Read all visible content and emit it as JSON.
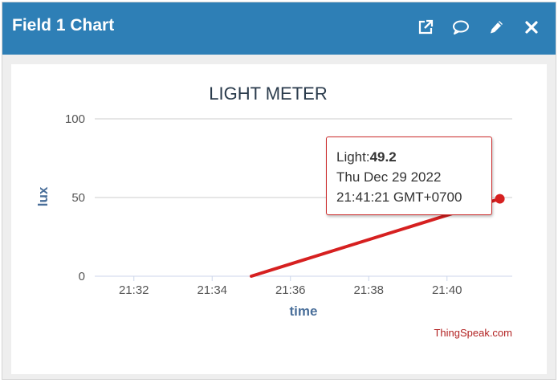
{
  "header": {
    "title": "Field 1 Chart",
    "bg_color": "#2e7fb6",
    "icons": [
      "external-link-icon",
      "comment-icon",
      "edit-pencil-icon",
      "close-icon"
    ]
  },
  "tooltip": {
    "series_label": "Light:",
    "value": "49.2",
    "date": "Thu Dec 29 2022",
    "time": "21:41:21 GMT+0700"
  },
  "credit": "ThingSpeak.com",
  "chart_data": {
    "type": "line",
    "title": "LIGHT METER",
    "xlabel": "time",
    "ylabel": "lux",
    "ylim": [
      0,
      100
    ],
    "yticks": [
      "0",
      "50",
      "100"
    ],
    "xlim": [
      "21:31:00",
      "21:41:40"
    ],
    "xticks": [
      "21:32",
      "21:34",
      "21:36",
      "21:38",
      "21:40"
    ],
    "grid": true,
    "line_color": "#d62020",
    "series": [
      {
        "points": [
          {
            "x": "21:35:00",
            "y": 0
          },
          {
            "x": "21:41:21",
            "y": 49.2
          }
        ]
      }
    ]
  }
}
